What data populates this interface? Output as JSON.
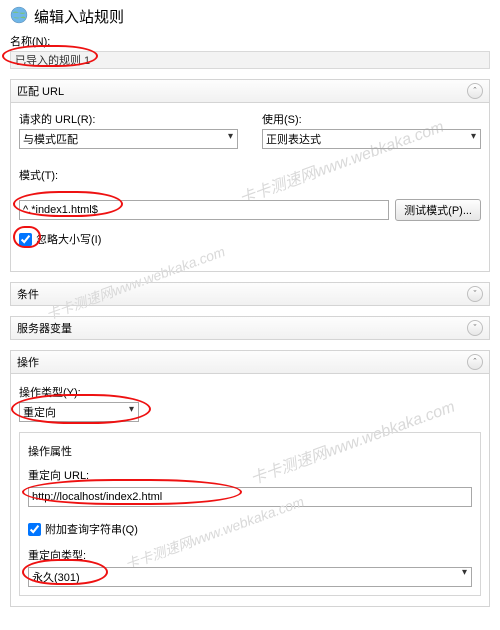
{
  "header": {
    "title": "编辑入站规则"
  },
  "name": {
    "label": "名称(N):",
    "value": "已导入的规则 1"
  },
  "match": {
    "panel_title": "匹配 URL",
    "req_url_label": "请求的 URL(R):",
    "req_url_value": "与模式匹配",
    "using_label": "使用(S):",
    "using_value": "正则表达式",
    "pattern_label": "模式(T):",
    "pattern_value": "^.*index1.html$",
    "test_btn": "测试模式(P)...",
    "ignore_case_label": "忽略大小写(I)",
    "ignore_case_checked": true
  },
  "conditions": {
    "panel_title": "条件"
  },
  "server_vars": {
    "panel_title": "服务器变量"
  },
  "action": {
    "panel_title": "操作",
    "type_label": "操作类型(Y):",
    "type_value": "重定向",
    "props_title": "操作属性",
    "redirect_url_label": "重定向 URL:",
    "redirect_url_value": "http://localhost/index2.html",
    "append_qs_label": "附加查询字符串(Q)",
    "append_qs_checked": true,
    "redirect_type_label": "重定向类型:",
    "redirect_type_value": "永久(301)"
  },
  "watermark": "卡卡测速网www.webkaka.com"
}
